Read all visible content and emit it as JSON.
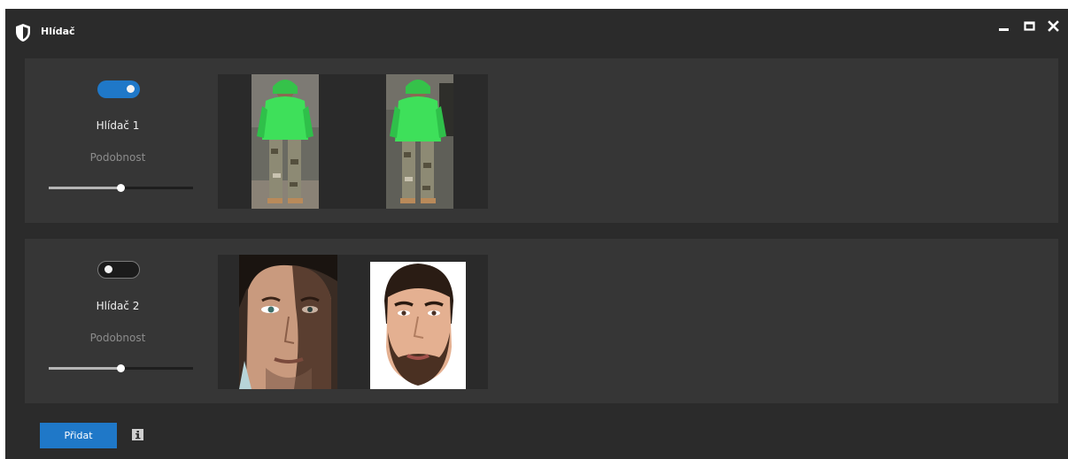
{
  "app": {
    "title": "Hlídač",
    "icon": "shield-icon"
  },
  "window_controls": {
    "minimize_icon": "minimize-icon",
    "maximize_icon": "maximize-icon",
    "close_icon": "close-icon"
  },
  "colors": {
    "window_bg": "#2b2b2b",
    "panel_bg": "#363636",
    "accent": "#1f78c8",
    "muted_text": "#8c8c8c"
  },
  "watchers": [
    {
      "name": "Hlídač 1",
      "enabled": true,
      "similarity_label": "Podobnost",
      "similarity_value": 0.5,
      "images": [
        "person-green-hoodie-photo",
        "person-green-hoodie-photo"
      ]
    },
    {
      "name": "Hlídač 2",
      "enabled": false,
      "similarity_label": "Podobnost",
      "similarity_value": 0.5,
      "images": [
        "face-photo",
        "face-photo"
      ]
    }
  ],
  "footer": {
    "add_label": "Přidat",
    "info_icon": "info-icon"
  }
}
